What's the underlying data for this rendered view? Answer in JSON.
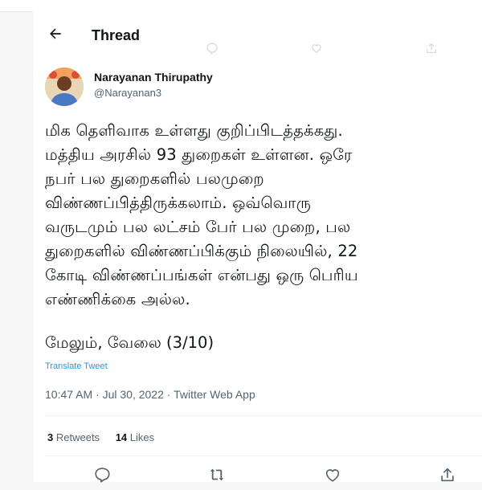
{
  "header": {
    "title": "Thread"
  },
  "tweet": {
    "author_name": "Narayanan Thirupathy",
    "author_handle": "@Narayanan3",
    "text_lines": [
      "மிக தெளிவாக உள்ளது குறிப்பிடத்தக்கது.",
      "மத்திய அரசில் 93 துறைகள் உள்ளன. ஒரே",
      "நபர் பல துறைகளில் பலமுறை",
      "விண்ணப்பித்திருக்கலாம். ஒவ்வொரு",
      "வருடமும் பல லட்சம் பேர் பல முறை, பல",
      "துறைகளில் விண்ணப்பிக்கும் நிலையில், 22",
      "கோடி விண்ணப்பங்கள் என்பது ஒரு பெரிய",
      "எண்ணிக்கை அல்ல."
    ],
    "text_more": "மேலும், வேலை (3/10)",
    "translate_label": "Translate Tweet",
    "meta": "10:47 AM · Jul 30, 2022 · Twitter Web App",
    "retweets_count": "3",
    "retweets_label": "Retweets",
    "likes_count": "14",
    "likes_label": "Likes"
  },
  "colors": {
    "accent": "#1d9bf0",
    "secondary_text": "#536471",
    "icon": "#536471"
  },
  "icons": {
    "back": "arrow-left-icon",
    "reply": "reply-icon",
    "retweet": "retweet-icon",
    "like": "heart-icon",
    "share": "share-icon"
  }
}
